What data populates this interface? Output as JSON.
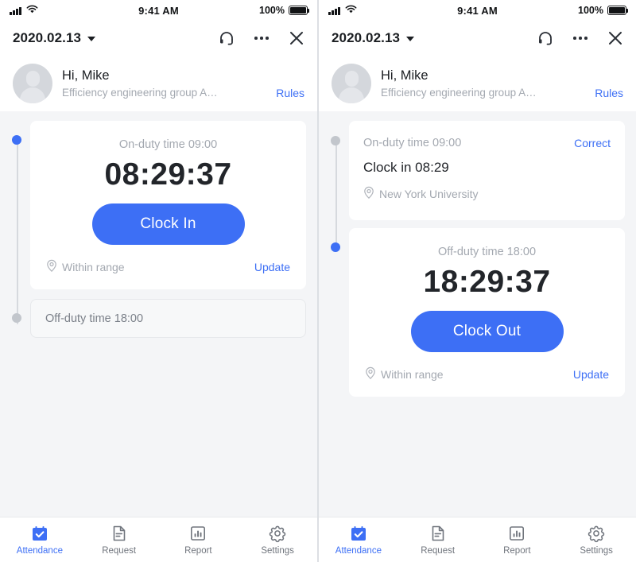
{
  "statusbar": {
    "time": "9:41 AM",
    "battery_pct": "100%",
    "signal_icon": "cellular-signal-icon",
    "wifi_icon": "wifi-icon",
    "battery_icon": "battery-full-icon"
  },
  "navbar": {
    "date": "2020.02.13",
    "caret_icon": "chevron-down-icon",
    "support_icon": "headset-icon",
    "more_icon": "ellipsis-icon",
    "close_icon": "close-icon"
  },
  "profile": {
    "avatar_icon": "user-avatar-placeholder",
    "greeting": "Hi, Mike",
    "department": "Efficiency engineering group A…",
    "rules_label": "Rules"
  },
  "colors": {
    "accent": "#3d6ff5",
    "page_bg": "#f4f5f7",
    "card_bg": "#ffffff",
    "muted_text": "#a3a8b0",
    "title_text": "#22252a",
    "timeline_inactive": "#c2c6cc"
  },
  "left_panel": {
    "timeline": [
      {
        "state": "active"
      },
      {
        "state": "inactive"
      }
    ],
    "active_card": {
      "duty_label": "On-duty time 09:00",
      "clock_value": "08:29:37",
      "button_label": "Clock In",
      "range_icon": "location-pin-icon",
      "range_label": "Within range",
      "update_label": "Update"
    },
    "pending_card": {
      "label": "Off-duty time 18:00"
    }
  },
  "right_panel": {
    "timeline": [
      {
        "state": "inactive"
      },
      {
        "state": "active"
      }
    ],
    "done_card": {
      "duty_label": "On-duty time 09:00",
      "correct_label": "Correct",
      "clock_record": "Clock in 08:29",
      "location_icon": "location-pin-icon",
      "location_label": "New York University"
    },
    "active_card": {
      "duty_label": "Off-duty time 18:00",
      "clock_value": "18:29:37",
      "button_label": "Clock Out",
      "range_icon": "location-pin-icon",
      "range_label": "Within range",
      "update_label": "Update"
    }
  },
  "tabbar": {
    "items": [
      {
        "label": "Attendance",
        "icon": "calendar-check-icon",
        "active": true
      },
      {
        "label": "Request",
        "icon": "document-icon",
        "active": false
      },
      {
        "label": "Report",
        "icon": "bar-chart-icon",
        "active": false
      },
      {
        "label": "Settings",
        "icon": "gear-icon",
        "active": false
      }
    ]
  }
}
